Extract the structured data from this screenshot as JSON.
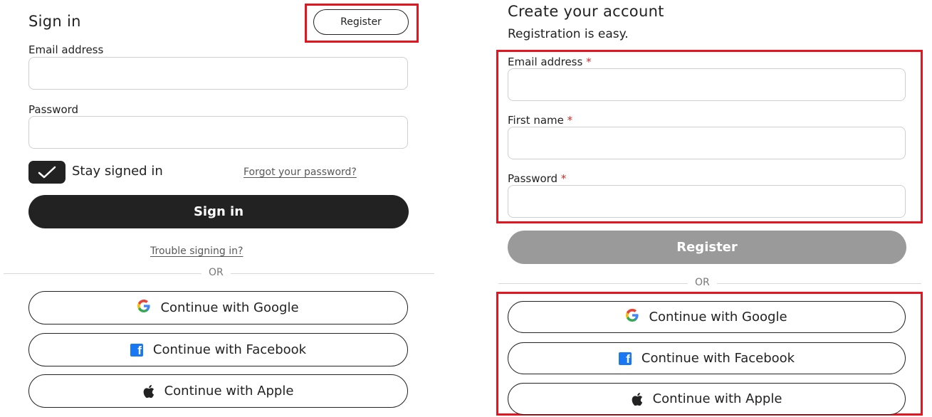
{
  "signin": {
    "title": "Sign in",
    "register_button": "Register",
    "email_label": "Email address",
    "password_label": "Password",
    "stay_signed_in": "Stay signed in",
    "forgot_password": "Forgot your password?",
    "submit": "Sign in",
    "trouble": "Trouble signing in?",
    "or": "OR",
    "google": "Continue with Google",
    "facebook": "Continue with Facebook",
    "apple": "Continue with Apple"
  },
  "register": {
    "title": "Create your account",
    "subtitle": "Registration is easy.",
    "email_label": "Email address",
    "first_name_label": "First name",
    "password_label": "Password",
    "required_marker": "*",
    "submit": "Register",
    "or": "OR",
    "google": "Continue with Google",
    "facebook": "Continue with Facebook",
    "apple": "Continue with Apple"
  },
  "icons": {
    "google": "google-icon",
    "facebook": "facebook-icon",
    "apple": "apple-icon",
    "check": "checkmark-icon"
  },
  "colors": {
    "primary_dark": "#222222",
    "primary_disabled": "#9a9a9a",
    "highlight_red": "#e5141e",
    "required_red": "#d42a2a",
    "facebook_blue": "#1877f2"
  }
}
